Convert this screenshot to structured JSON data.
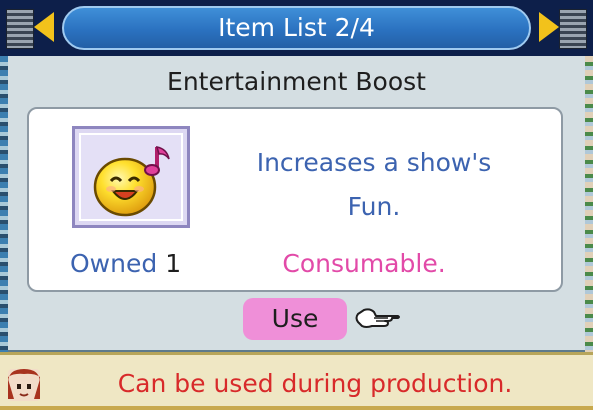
{
  "header": {
    "title": "Item List 2/4",
    "prev_icon": "arrow-left-icon",
    "next_icon": "arrow-right-icon",
    "accent": "#f2c21b"
  },
  "item": {
    "name": "Entertainment Boost",
    "icon": "smiley-music-note-icon",
    "description_line1": "Increases a show's",
    "description_line2": "Fun.",
    "owned_label": "Owned",
    "owned_count": "1",
    "type": "Consumable."
  },
  "actions": {
    "use_label": "Use",
    "pointer_icon": "pointing-hand-icon"
  },
  "status": {
    "message": "Can be used during production.",
    "avatar_icon": "character-avatar-icon",
    "color": "#d82a2a"
  }
}
